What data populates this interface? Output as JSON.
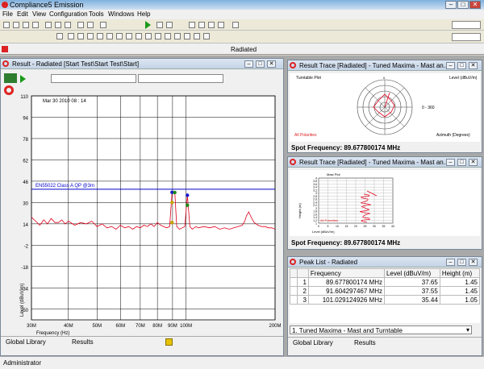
{
  "app": {
    "title": "Compliance5 Emission"
  },
  "window_controls": {
    "minimize": "–",
    "maximize": "□",
    "close": "✕"
  },
  "menu": [
    "File",
    "Edit",
    "View",
    "Configuration",
    "Tools",
    "Windows",
    "Help"
  ],
  "tab": {
    "label": "Radiated"
  },
  "result_window": {
    "title": "Result - Radiated [Start Test\\Start Test\\Start]",
    "date": "Mar 30 2010  08 : 14",
    "limit_label": "EN55022 Class A QP @3m"
  },
  "chart_data": {
    "type": "line",
    "title": "",
    "xlabel": "Frequency (Hz)",
    "ylabel": "Level (dBuV/m)",
    "x_scale": "log",
    "xlim": [
      30,
      200
    ],
    "ylim": [
      -58,
      110
    ],
    "y_ticks": [
      "110",
      "94",
      "78",
      "62",
      "46",
      "30",
      "14",
      "-2",
      "-18",
      "-34",
      "-50"
    ],
    "x_ticks": [
      {
        "value": 30,
        "label": "30M"
      },
      {
        "value": 40,
        "label": "40M"
      },
      {
        "value": 50,
        "label": "50M"
      },
      {
        "value": 60,
        "label": "60M"
      },
      {
        "value": 70,
        "label": "70M"
      },
      {
        "value": 80,
        "label": "80M"
      },
      {
        "value": 90,
        "label": "90M"
      },
      {
        "value": 100,
        "label": "100M"
      },
      {
        "value": 200,
        "label": "200M"
      }
    ],
    "grid": true,
    "limit_line": {
      "name": "EN55022 Class A QP @3m",
      "y": 40,
      "color": "#0000cc"
    },
    "trace_color": "#e0001b",
    "trace": {
      "x": [
        30,
        31,
        32,
        33,
        34,
        35,
        36,
        37,
        38,
        39,
        40,
        42,
        44,
        46,
        48,
        50,
        52,
        54,
        56,
        58,
        60,
        62,
        64,
        66,
        68,
        70,
        72,
        74,
        76,
        78,
        80,
        82,
        84,
        86,
        88,
        89.68,
        91.6,
        93,
        95,
        97,
        99,
        101.03,
        103,
        105,
        108,
        110,
        115,
        120,
        125,
        130,
        135,
        140,
        145,
        150,
        155,
        158,
        160,
        163,
        166,
        170,
        175,
        180,
        185,
        190,
        195,
        200
      ],
      "y": [
        19,
        16,
        13,
        17,
        14,
        18,
        15,
        15,
        17,
        14,
        16,
        13,
        15,
        14,
        16,
        12,
        14,
        11,
        12,
        10,
        13,
        11,
        12,
        10,
        12,
        11,
        13,
        12,
        14,
        12,
        15,
        13,
        12,
        11,
        12,
        37.65,
        37.55,
        12,
        10,
        11,
        12,
        35.44,
        12,
        10,
        12,
        11,
        12,
        11,
        12,
        10,
        11,
        10,
        11,
        12,
        13,
        16,
        20,
        23,
        19,
        15,
        13,
        12,
        12,
        11,
        11,
        10
      ]
    },
    "markers": [
      {
        "x": 89.68,
        "y": 37.65
      },
      {
        "x": 91.6,
        "y": 37.55
      },
      {
        "x": 101.03,
        "y": 35.44
      },
      {
        "x": 89.68,
        "y": 30
      },
      {
        "x": 101.03,
        "y": 28
      },
      {
        "x": 89.68,
        "y": 15
      }
    ]
  },
  "status_left": {
    "library": "Global Library",
    "results": "Results"
  },
  "trace_window_1": {
    "title": "Result Trace [Radiated] - Tuned Maxima - Mast an...",
    "plot_label": "Turntable Plot",
    "level_label": "Level (dBuV/m)",
    "angle_0": "0",
    "angle_360": "0 - 360",
    "polar_label": "All Polarities",
    "azimuth_label": "Azimuth (Degrees)",
    "spot": "Spot Frequency: 89.677800174 MHz"
  },
  "trace_window_2": {
    "title": "Result Trace [Radiated] - Tuned Maxima - Mast an...",
    "plot_label": "Mast Plot",
    "y_axis": "Height (m)",
    "x_axis": "Level (dBuV/m)",
    "polar_label": "All Polarities",
    "y_ticks": [
      "4",
      "3.8",
      "3.6",
      "3.4",
      "3.2",
      "3",
      "2.8",
      "2.6",
      "2.4",
      "2.2",
      "2",
      "1.8",
      "1.6",
      "1.4",
      "1.2",
      "1"
    ],
    "x_ticks": [
      "0",
      "5",
      "10",
      "15",
      "20",
      "25",
      "30",
      "35",
      "40"
    ],
    "spot": "Spot Frequency: 89.677800174 MHz"
  },
  "peak_list": {
    "title": "Peak List - Radiated",
    "columns": [
      "Frequency",
      "Level (dBuV/m)",
      "Height (m)"
    ],
    "rows": [
      {
        "n": "1",
        "freq": "89.677800174 MHz",
        "level": "37.65",
        "height": "1.45"
      },
      {
        "n": "2",
        "freq": "91.604297467 MHz",
        "level": "37.55",
        "height": "1.45"
      },
      {
        "n": "3",
        "freq": "101.029124926 MHz",
        "level": "35.44",
        "height": "1.05"
      }
    ],
    "dropdown": "1. Tuned Maxima - Mast and Turntable"
  },
  "status_right": {
    "library": "Global Library",
    "results": "Results"
  },
  "status_bar": {
    "user": "Administrator"
  },
  "colors": {
    "trace": "#e0001b",
    "limit": "#0000cc",
    "accent": "#d22222"
  }
}
